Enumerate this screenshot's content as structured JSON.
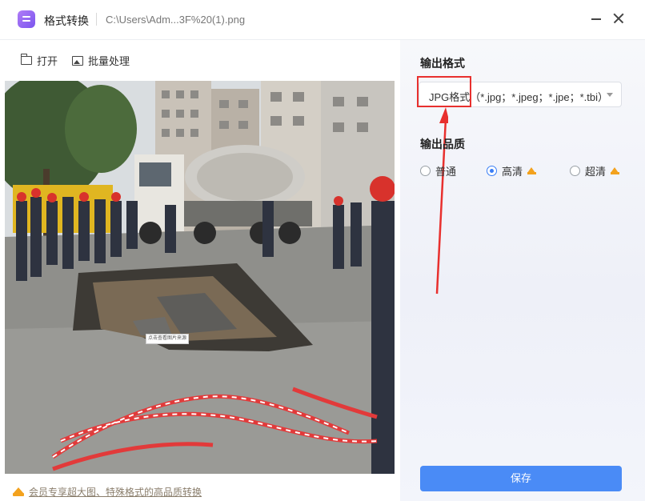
{
  "titlebar": {
    "app_title": "格式转换",
    "file_path": "C:\\Users\\Adm...3F%20(1).png"
  },
  "toolbar": {
    "open_label": "打开",
    "batch_label": "批量处理"
  },
  "preview": {
    "watermark_text": "点击查看图片来源"
  },
  "vip_notice": "会员专享超大图、特殊格式的高品质转换",
  "output": {
    "format_label": "输出格式",
    "format_value": "JPG格式（*.jpg；*.jpeg；*.jpe；*.tbi）",
    "quality_label": "输出品质",
    "quality_options": [
      {
        "label": "普通",
        "checked": false,
        "vip": false
      },
      {
        "label": "高清",
        "checked": true,
        "vip": true
      },
      {
        "label": "超清",
        "checked": false,
        "vip": true
      }
    ]
  },
  "save_label": "保存",
  "colors": {
    "accent": "#4a8bf6",
    "highlight": "#e8302e",
    "crown": "#f3a21e"
  },
  "icons": [
    "app-logo-icon",
    "folder-open-icon",
    "image-icon",
    "minimize-icon",
    "close-icon",
    "crown-icon",
    "dropdown-caret-icon"
  ]
}
